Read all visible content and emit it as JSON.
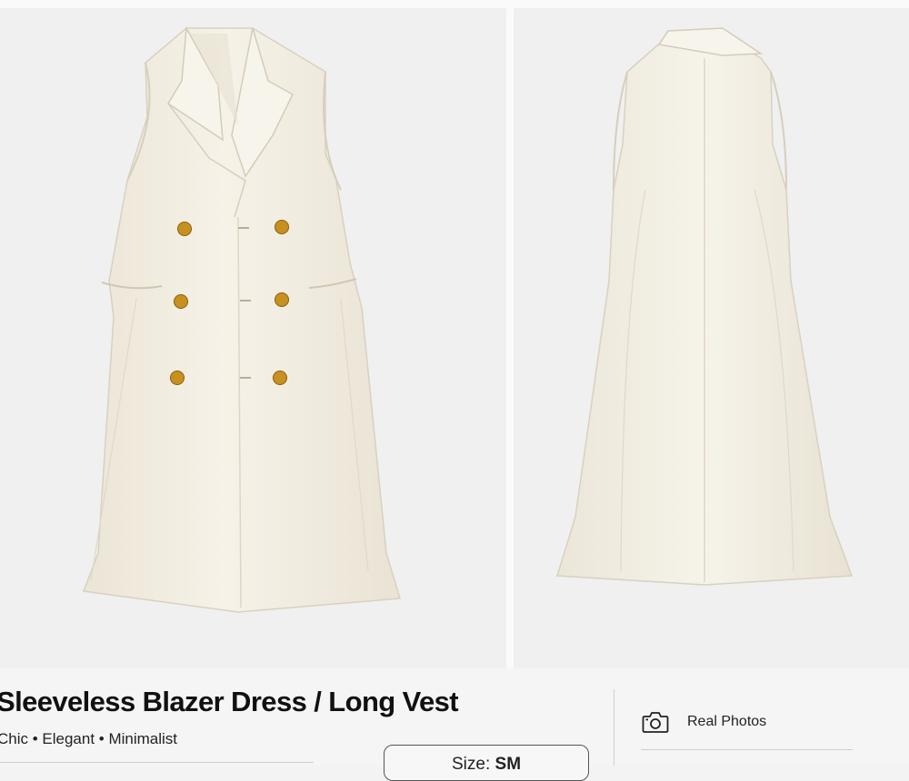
{
  "product": {
    "title": "Sleeveless Blazer Dress / Long Vest",
    "tags": "Chic • Elegant • Minimalist"
  },
  "size": {
    "label": "Size:",
    "value": "SM"
  },
  "real_photos": {
    "label": "Real Photos",
    "icon": "camera-icon"
  },
  "photos": [
    {
      "view": "front",
      "icon": "dress-front-image"
    },
    {
      "view": "back",
      "icon": "dress-back-image"
    }
  ],
  "colors": {
    "garment": "#f2ede1",
    "button": "#c8901e",
    "background": "#f0f0f0"
  }
}
